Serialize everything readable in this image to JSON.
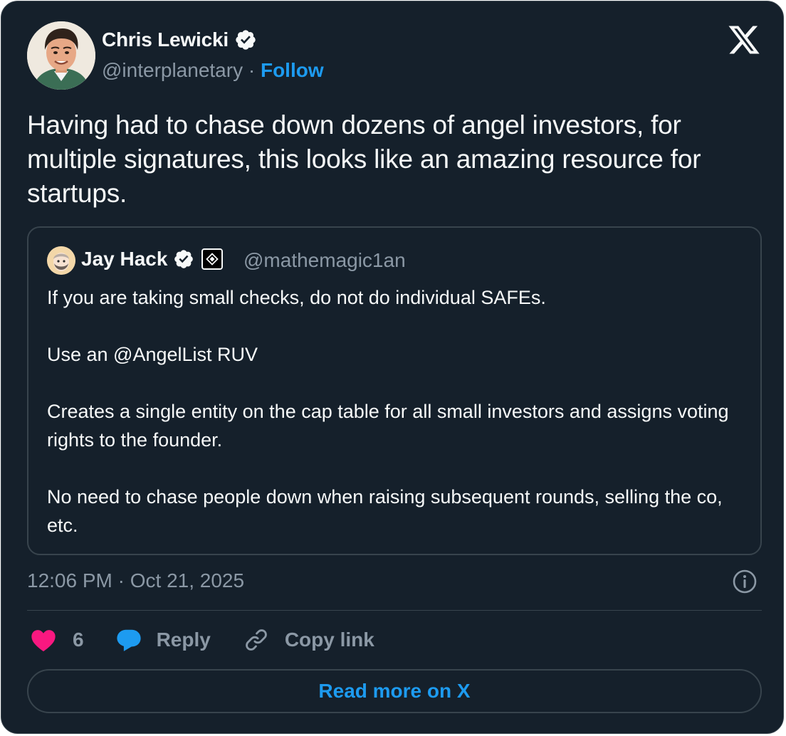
{
  "tweet": {
    "author": {
      "name": "Chris Lewicki",
      "handle": "@interplanetary",
      "separator": "·",
      "follow_label": "Follow",
      "verified": true
    },
    "text": "Having had to chase down dozens of angel investors, for multiple signatures, this looks like an amazing resource for startups.",
    "quoted": {
      "author_name": "Jay Hack",
      "handle": "@mathemagic1an",
      "verified": true,
      "paragraphs": [
        "If you are taking small checks, do not do individual SAFEs.",
        "Use an @AngelList RUV",
        "Creates a single entity on the cap table for all small investors and assigns voting rights to the founder.",
        "No need to chase people down when raising subsequent rounds, selling the co, etc."
      ]
    },
    "timestamp": "12:06 PM · Oct 21, 2025",
    "actions": {
      "like_count": "6",
      "reply_label": "Reply",
      "copy_link_label": "Copy link"
    },
    "read_more_label": "Read more on X"
  },
  "icons": [
    "x-logo-icon",
    "verified-badge-icon",
    "affiliate-badge-icon",
    "info-icon",
    "heart-icon",
    "reply-bubble-icon",
    "link-icon"
  ],
  "colors": {
    "background": "#15202b",
    "border": "#38444d",
    "text_primary": "#f7f9f9",
    "text_secondary": "#8b98a5",
    "accent": "#1d9bf0",
    "like": "#f91880"
  }
}
